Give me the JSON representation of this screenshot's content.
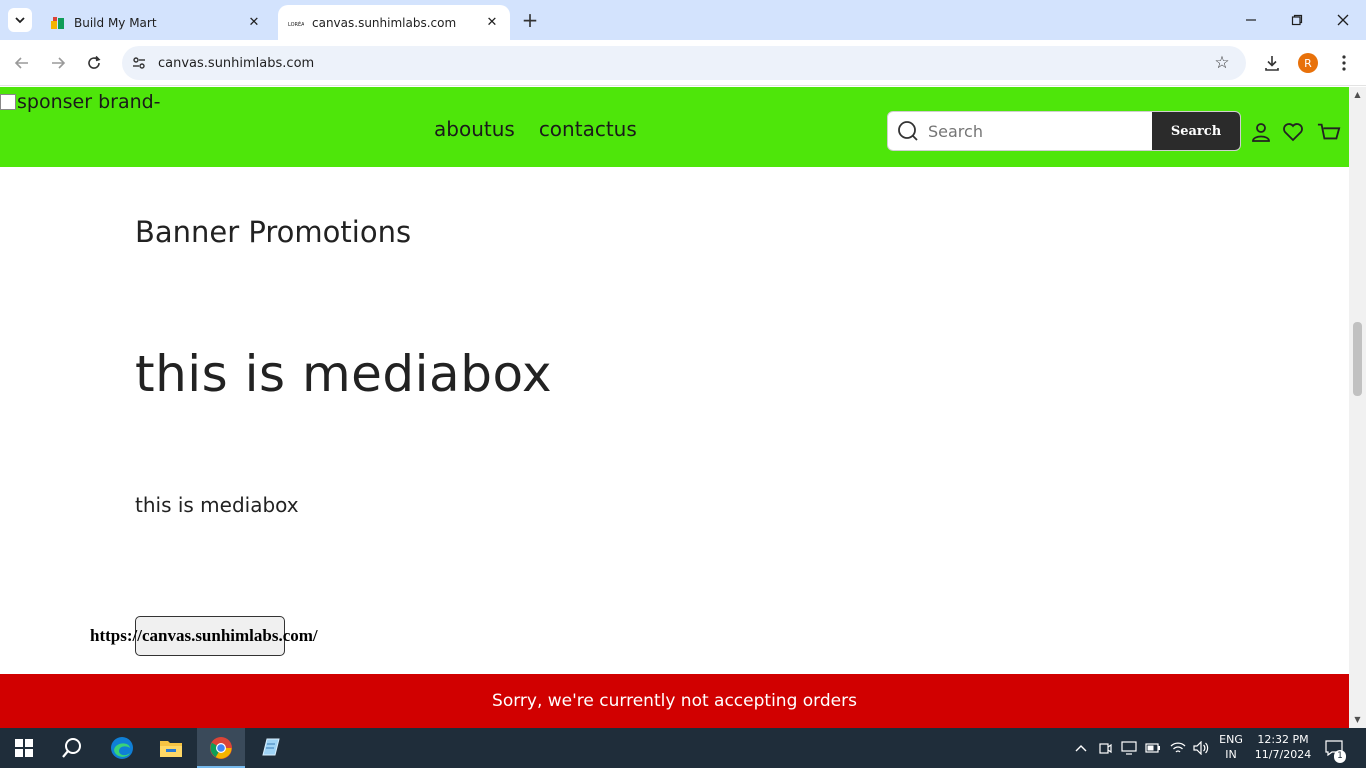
{
  "browser": {
    "tabs": [
      {
        "title": "Build My Mart",
        "active": false
      },
      {
        "title": "canvas.sunhimlabs.com",
        "active": true
      }
    ],
    "new_tab_label": "+",
    "url": "canvas.sunhimlabs.com",
    "profile_initial": "R"
  },
  "site": {
    "brand_alt": "sponser brand-",
    "nav": [
      {
        "label": "aboutus"
      },
      {
        "label": "contactus"
      }
    ],
    "search": {
      "placeholder": "Search",
      "button_label": "Search"
    },
    "colors": {
      "header_bg": "#4ee60a",
      "notice_bg": "#d10000"
    }
  },
  "content": {
    "section_title": "Banner Promotions",
    "media_heading": "this is mediabox",
    "media_text": "this is mediabox",
    "link_text": "https://canvas.sunhimlabs.com/"
  },
  "notice": {
    "text": "Sorry, we're currently not accepting orders"
  },
  "taskbar": {
    "language_top": "ENG",
    "language_bottom": "IN",
    "time": "12:32 PM",
    "date": "11/7/2024",
    "notification_count": "1"
  }
}
